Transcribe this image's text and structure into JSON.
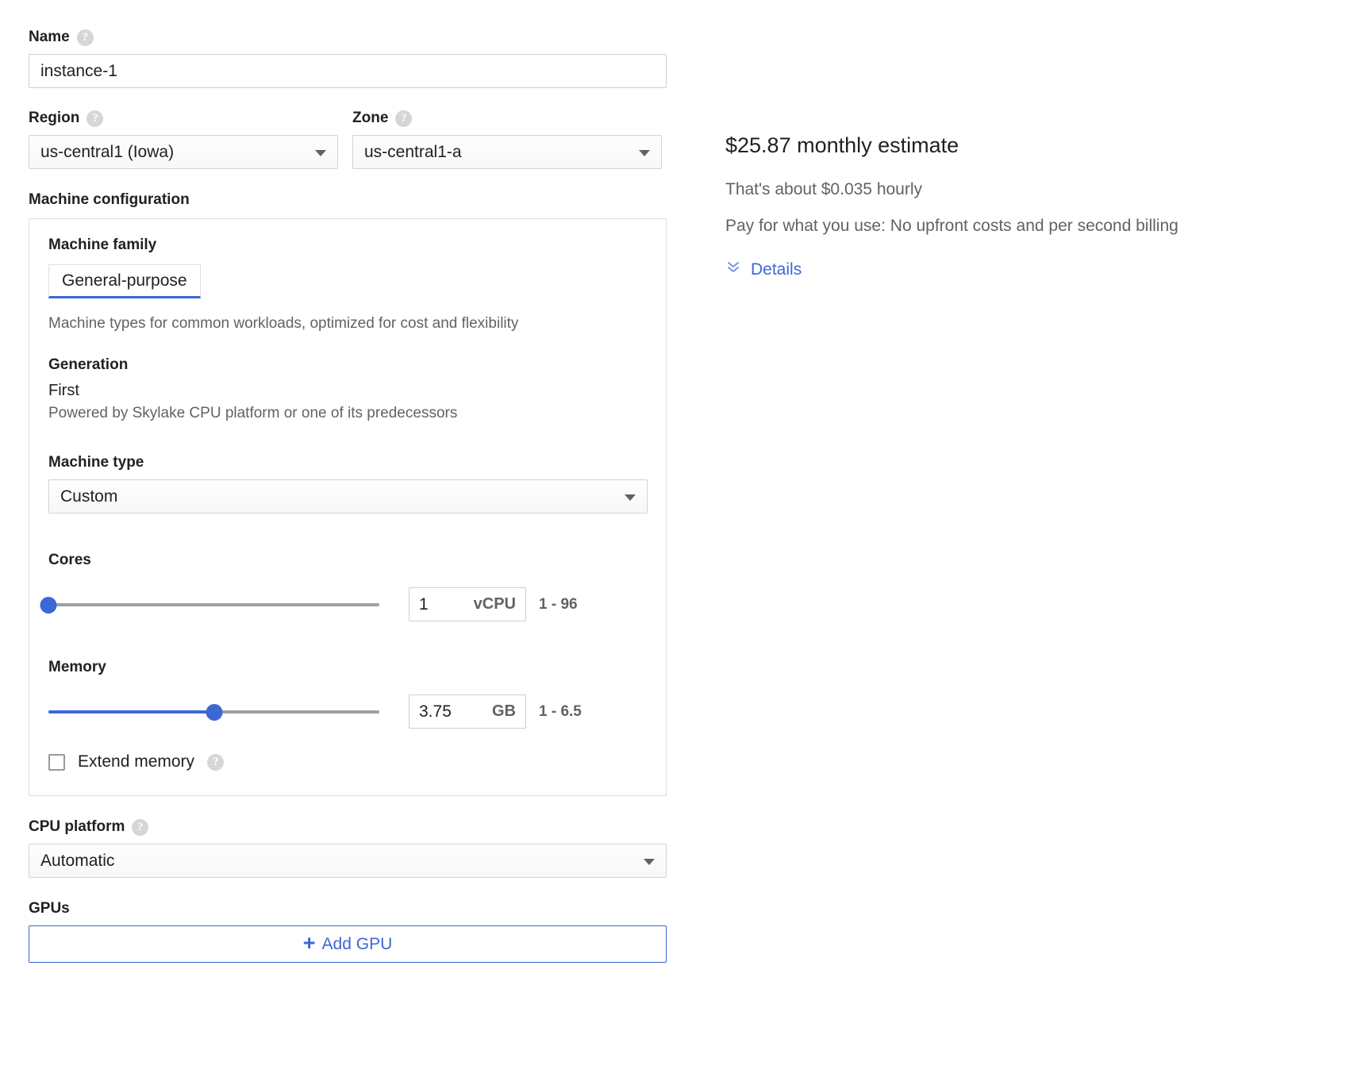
{
  "form": {
    "name": {
      "label": "Name",
      "value": "instance-1",
      "placeholder": "instance-1"
    },
    "region": {
      "label": "Region",
      "value": "us-central1 (Iowa)"
    },
    "zone": {
      "label": "Zone",
      "value": "us-central1-a"
    },
    "machine_configuration": {
      "section_label": "Machine configuration",
      "machine_family": {
        "label": "Machine family",
        "selected_tab": "General-purpose",
        "description": "Machine types for common workloads, optimized for cost and flexibility"
      },
      "generation": {
        "label": "Generation",
        "value": "First",
        "description": "Powered by Skylake CPU platform or one of its predecessors"
      },
      "machine_type": {
        "label": "Machine type",
        "value": "Custom"
      },
      "cores": {
        "label": "Cores",
        "value": "1",
        "unit": "vCPU",
        "range_text": "1 - 96",
        "min": 1,
        "max": 96,
        "fill_percent": 0
      },
      "memory": {
        "label": "Memory",
        "value": "3.75",
        "unit": "GB",
        "range_text": "1 - 6.5",
        "min": 1,
        "max": 6.5,
        "fill_percent": 50
      },
      "extend_memory": {
        "label": "Extend memory",
        "checked": false
      }
    },
    "cpu_platform": {
      "label": "CPU platform",
      "value": "Automatic"
    },
    "gpus": {
      "label": "GPUs",
      "add_button_label": "Add GPU"
    }
  },
  "estimate": {
    "title": "$25.87 monthly estimate",
    "hourly": "That's about $0.035 hourly",
    "note": "Pay for what you use: No upfront costs and per second billing",
    "details_label": "Details"
  },
  "colors": {
    "accent_blue": "#3b68d4",
    "text_primary": "#202124",
    "text_secondary": "#5f6368",
    "border": "#dadce0",
    "track_gray": "#9aa0a6"
  }
}
